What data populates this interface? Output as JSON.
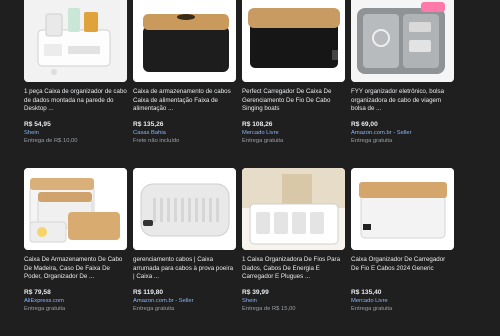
{
  "products": [
    {
      "title": "1 peça Caixa de organizador de cabo de dados montada na parede do Desktop ...",
      "price": "R$ 54,95",
      "seller": "Shein",
      "shipping": "Entrega de R$ 10,00"
    },
    {
      "title": "Caixa de armazenamento de cabos Caixa de alimentação Faixa de alimentação ...",
      "price": "R$ 135,26",
      "seller": "Casas Bahia",
      "shipping": "Frete não incluído"
    },
    {
      "title": "Perfect Carregador De Caixa De Gerenciamento De Fio De Cabo Singing boats",
      "price": "R$ 108,26",
      "seller": "Mercado Livre",
      "shipping": "Entrega gratuita"
    },
    {
      "title": "FYY organizador eletrônico, bolsa organizadora de cabo de viagem bolsa de ...",
      "price": "R$ 69,00",
      "seller": "Amazon.com.br - Seller",
      "shipping": "Entrega gratuita"
    },
    {
      "title": "Caixa De Armazenamento De Cabo De Madeira, Caso De Faixa De Poder, Organizador De ...",
      "price": "R$ 79,58",
      "seller": "AliExpress.com",
      "shipping": "Entrega gratuita"
    },
    {
      "title": "gerenciamento cabos | Caixa arrumada para cabos à prova poeira | Caixa ...",
      "price": "R$ 119,80",
      "seller": "Amazon.com.br - Seller",
      "shipping": "Entrega gratuita"
    },
    {
      "title": "1 Caixa Organizadora De Fios Para Dados, Cabos De Energia E Carregador E Plugues ...",
      "price": "R$ 39,99",
      "seller": "Shein",
      "shipping": "Entrega de R$ 15,00"
    },
    {
      "title": "Caixa Organizador De Carregador De Fio E Cabos 2024 Generic",
      "price": "R$ 135,40",
      "seller": "Mercado Livre",
      "shipping": "Entrega gratuita"
    }
  ]
}
